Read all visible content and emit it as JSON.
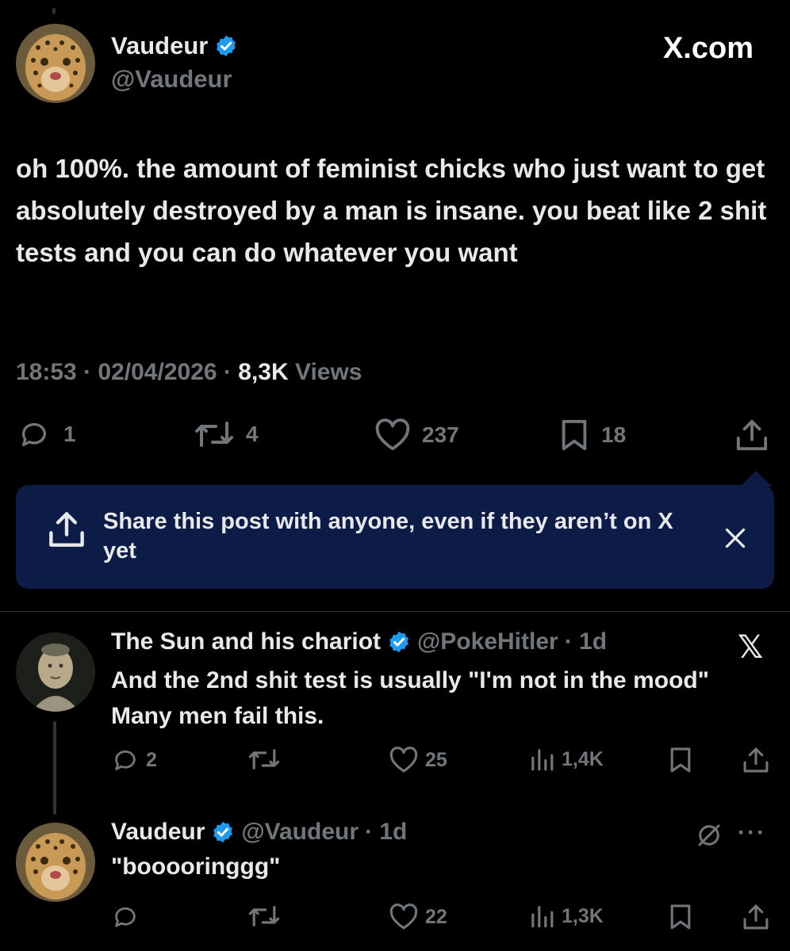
{
  "main_tweet": {
    "author_name": "Vaudeur",
    "author_handle": "@Vaudeur",
    "brand": "X.com",
    "text": "oh 100%. the amount of feminist chicks who just want to get absolutely destroyed by a man is insane. you beat like 2 shit tests and you can do whatever you want",
    "time": "18:53",
    "date": "02/04/2026",
    "views_count": "8,3K",
    "views_label": "Views",
    "separator": "·",
    "replies": "1",
    "reposts": "4",
    "likes": "237",
    "bookmarks": "18"
  },
  "share_banner": {
    "text": "Share this post with anyone, even if they aren’t on X yet"
  },
  "reply_1": {
    "author_name": "The Sun and his chariot",
    "author_handle": "@PokeHitler",
    "age": "· 1d",
    "text": "And the 2nd shit test is usually \"I'm not in the mood\" Many men fail this.",
    "replies": "2",
    "likes": "25",
    "views": "1,4K"
  },
  "reply_2": {
    "author_name": "Vaudeur",
    "author_handle": "@Vaudeur",
    "age": "· 1d",
    "text": "\"booooringgg\"",
    "likes": "22",
    "views": "1,3K",
    "more": "···"
  },
  "icons": [
    "verified-badge-icon",
    "reply-icon",
    "repost-icon",
    "like-icon",
    "bookmark-icon",
    "share-icon",
    "close-icon",
    "x-logo-icon",
    "views-icon",
    "grok-icon",
    "more-icon"
  ],
  "colors": {
    "background": "#000000",
    "text": "#e7e9ea",
    "muted": "#71767b",
    "verified": "#1d9bf0",
    "banner": "#0d1c47",
    "divider": "#2f3336"
  }
}
